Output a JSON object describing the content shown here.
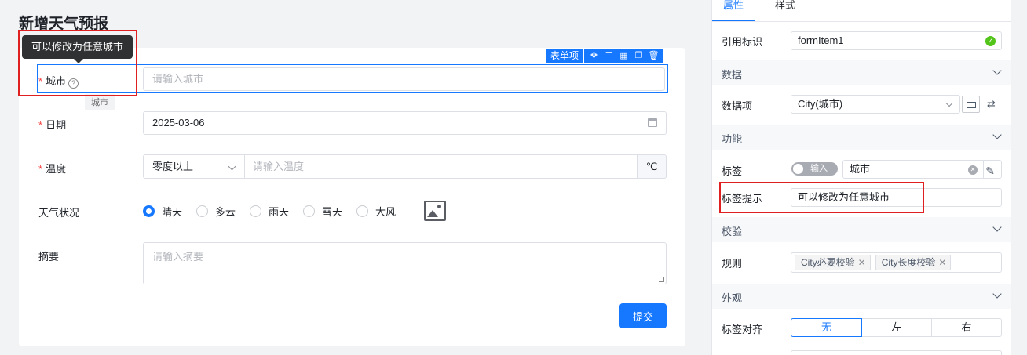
{
  "designer": {
    "page_title": "新增天气预报",
    "tooltip": "可以修改为任意城市",
    "selected_tag": "表单项",
    "selected_icons": [
      "move-icon",
      "align-top-icon",
      "grid-icon",
      "copy-icon",
      "delete-icon"
    ],
    "selected_field_tag": "城市",
    "fields": {
      "city": {
        "label": "城市",
        "required": true,
        "help": "?",
        "placeholder": "请输入城市"
      },
      "date": {
        "label": "日期",
        "required": true,
        "value": "2025-03-06"
      },
      "temperature": {
        "label": "温度",
        "required": true,
        "select_value": "零度以上",
        "placeholder": "请输入温度",
        "unit": "℃"
      },
      "weather": {
        "label": "天气状况",
        "options": [
          "晴天",
          "多云",
          "雨天",
          "雪天",
          "大风"
        ],
        "selected": "晴天"
      },
      "summary": {
        "label": "摘要",
        "placeholder": "请输入摘要"
      }
    },
    "submit_label": "提交"
  },
  "panel": {
    "tabs": [
      {
        "label": "属性",
        "active": true
      },
      {
        "label": "样式",
        "active": false
      }
    ],
    "ref_id": {
      "label": "引用标识",
      "value": "formItem1"
    },
    "sections": {
      "data": "数据",
      "function": "功能",
      "validation": "校验",
      "appearance": "外观"
    },
    "data_item": {
      "label": "数据项",
      "value": "City(城市)"
    },
    "tag": {
      "label": "标签",
      "switch_label": "输入",
      "value": "城市"
    },
    "tag_hint": {
      "label": "标签提示",
      "value": "可以修改为任意城市"
    },
    "rules": {
      "label": "规则",
      "chips": [
        "City必要校验",
        "City长度校验"
      ]
    },
    "label_align": {
      "label": "标签对齐",
      "options": [
        "无",
        "左",
        "右"
      ],
      "selected": "无"
    }
  },
  "colors": {
    "primary": "#1677ff",
    "required": "#f53f3f",
    "highlight": "#e02020",
    "success": "#52c41a"
  }
}
